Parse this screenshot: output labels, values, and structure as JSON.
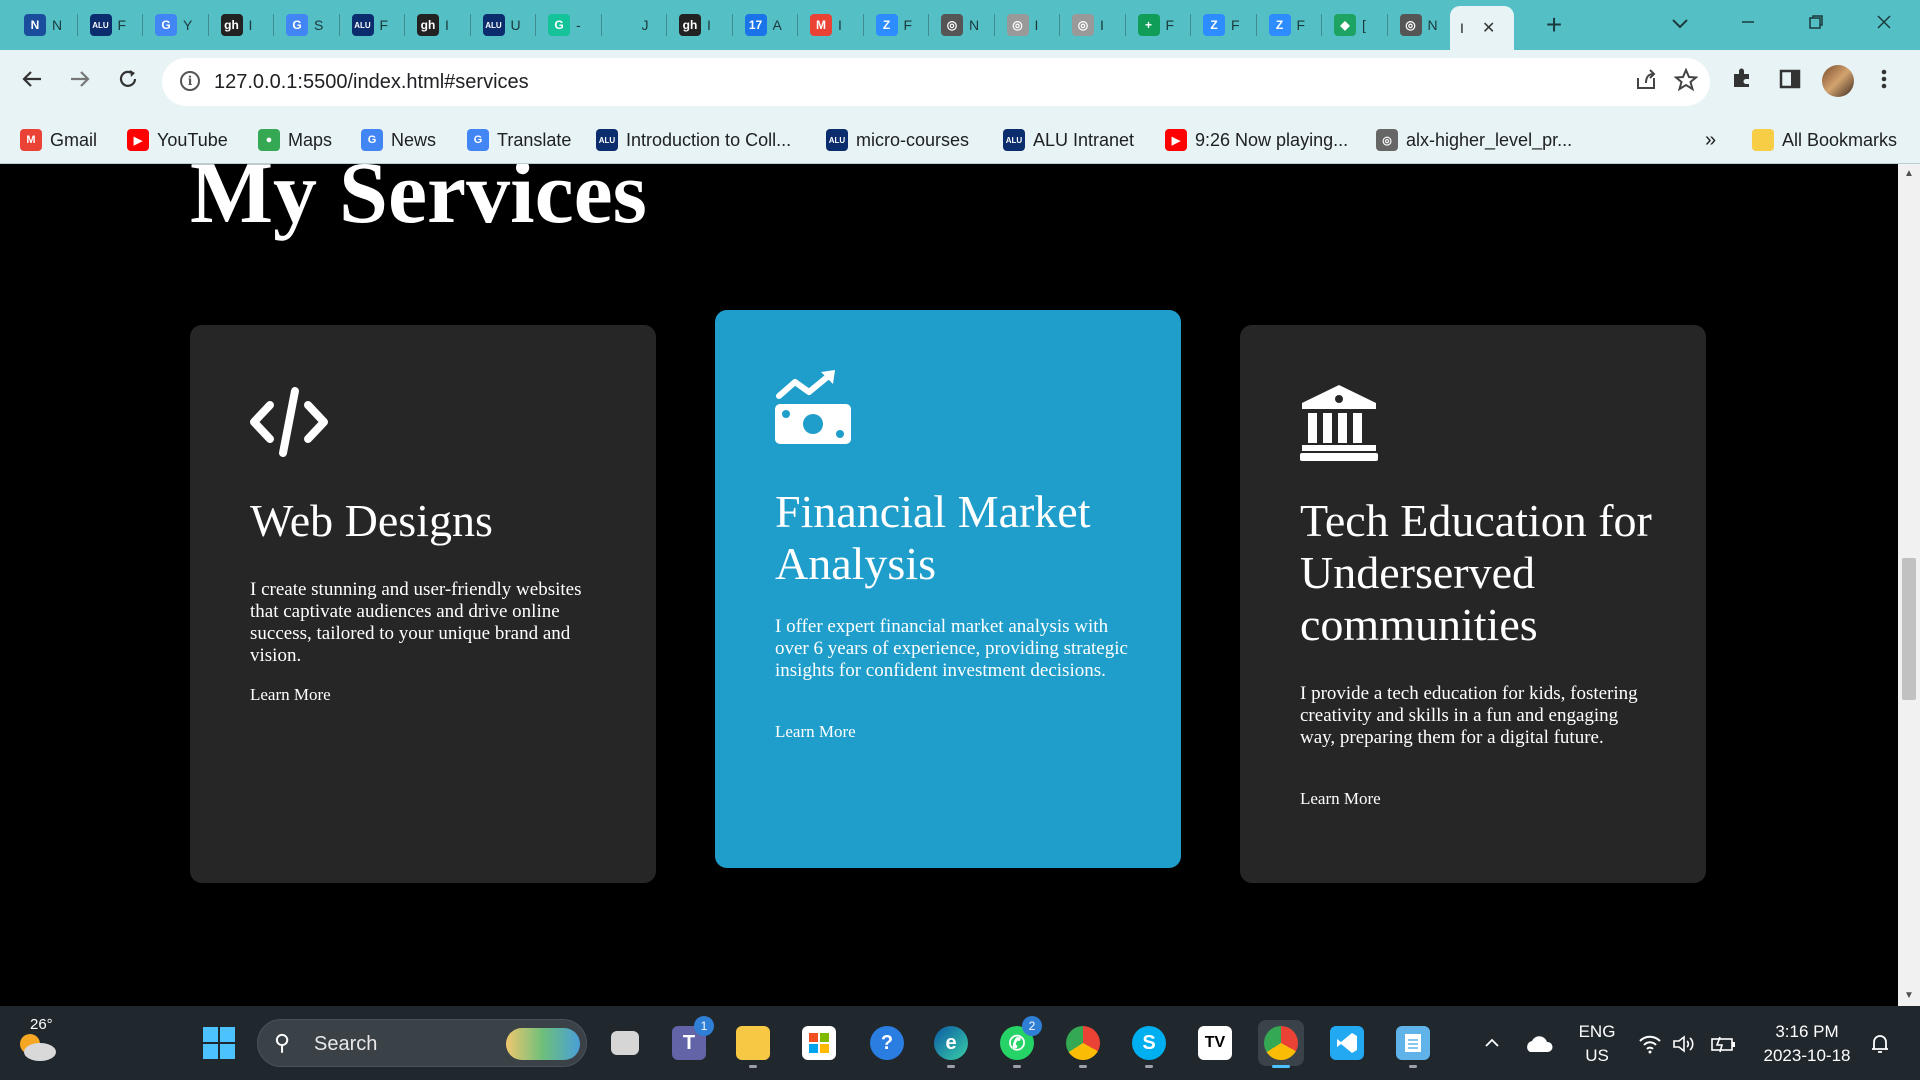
{
  "browser": {
    "tabs": [
      {
        "label": "N",
        "fav": "N",
        "color": "#1a4d9c"
      },
      {
        "label": "F",
        "fav": "ALU",
        "color": "#0b2d6e"
      },
      {
        "label": "Y",
        "fav": "G",
        "color": "#4285f4"
      },
      {
        "label": "I",
        "fav": "gh",
        "color": "#222"
      },
      {
        "label": "S",
        "fav": "G",
        "color": "#4285f4"
      },
      {
        "label": "F",
        "fav": "ALU",
        "color": "#0b2d6e"
      },
      {
        "label": "I",
        "fav": "gh",
        "color": "#222"
      },
      {
        "label": "U",
        "fav": "ALU",
        "color": "#0b2d6e"
      },
      {
        "label": "-",
        "fav": "G",
        "color": "#15c39a"
      },
      {
        "label": "J",
        "fav": "",
        "color": "#55bfc6"
      },
      {
        "label": "I",
        "fav": "gh",
        "color": "#222"
      },
      {
        "label": "A",
        "fav": "17",
        "color": "#1a73e8"
      },
      {
        "label": "I",
        "fav": "M",
        "color": "#ea4335"
      },
      {
        "label": "F",
        "fav": "Z",
        "color": "#2d8cff"
      },
      {
        "label": "N",
        "fav": "◎",
        "color": "#555"
      },
      {
        "label": "I",
        "fav": "◎",
        "color": "#999"
      },
      {
        "label": "I",
        "fav": "◎",
        "color": "#999"
      },
      {
        "label": "F",
        "fav": "+",
        "color": "#0f9d58"
      },
      {
        "label": "F",
        "fav": "Z",
        "color": "#2d8cff"
      },
      {
        "label": "F",
        "fav": "Z",
        "color": "#2d8cff"
      },
      {
        "label": "[",
        "fav": "◆",
        "color": "#1da462"
      },
      {
        "label": "N",
        "fav": "◎",
        "color": "#555"
      }
    ],
    "active_tab": {
      "label": "I",
      "close": "✕"
    },
    "new_tab": "+",
    "url": "127.0.0.1:5500/index.html#services",
    "info_icon": "i",
    "bookmarks": [
      {
        "label": "Gmail",
        "icon": "M",
        "color": "#ea4335"
      },
      {
        "label": "YouTube",
        "icon": "▶",
        "color": "#ff0000"
      },
      {
        "label": "Maps",
        "icon": "●",
        "color": "#34a853"
      },
      {
        "label": "News",
        "icon": "G",
        "color": "#4285f4"
      },
      {
        "label": "Translate",
        "icon": "G",
        "color": "#4285f4"
      },
      {
        "label": "Introduction to Coll...",
        "icon": "ALU",
        "color": "#0b2d6e"
      },
      {
        "label": "micro-courses",
        "icon": "ALU",
        "color": "#0b2d6e"
      },
      {
        "label": "ALU Intranet",
        "icon": "ALU",
        "color": "#0b2d6e"
      },
      {
        "label": "9:26 Now playing...",
        "icon": "▶",
        "color": "#ff0000"
      },
      {
        "label": "alx-higher_level_pr...",
        "icon": "◎",
        "color": "#666"
      }
    ],
    "bookmarks_overflow": "»",
    "all_bookmarks": "All Bookmarks"
  },
  "page": {
    "heading": "My Services",
    "cards": [
      {
        "icon": "code-icon",
        "title": "Web Designs",
        "description": "I create stunning and user-friendly websites that captivate audiences and drive online success, tailored to your unique brand and vision.",
        "link": "Learn More"
      },
      {
        "icon": "money-chart-icon",
        "title": "Financial Market Analysis",
        "description": "I offer expert financial market analysis with over 6 years of experience, providing strategic insights for confident investment decisions.",
        "link": "Learn More"
      },
      {
        "icon": "institution-icon",
        "title": "Tech Education for Underserved communities",
        "description": "I provide a tech education for kids, fostering creativity and skills in a fun and engaging way, preparing them for a digital future.",
        "link": "Learn More"
      }
    ]
  },
  "taskbar": {
    "temperature": "26°",
    "search_placeholder": "Search",
    "teams_badge": "1",
    "whatsapp_badge": "2",
    "language": "ENG",
    "region": "US",
    "time": "3:16 PM",
    "date": "2023-10-18"
  }
}
